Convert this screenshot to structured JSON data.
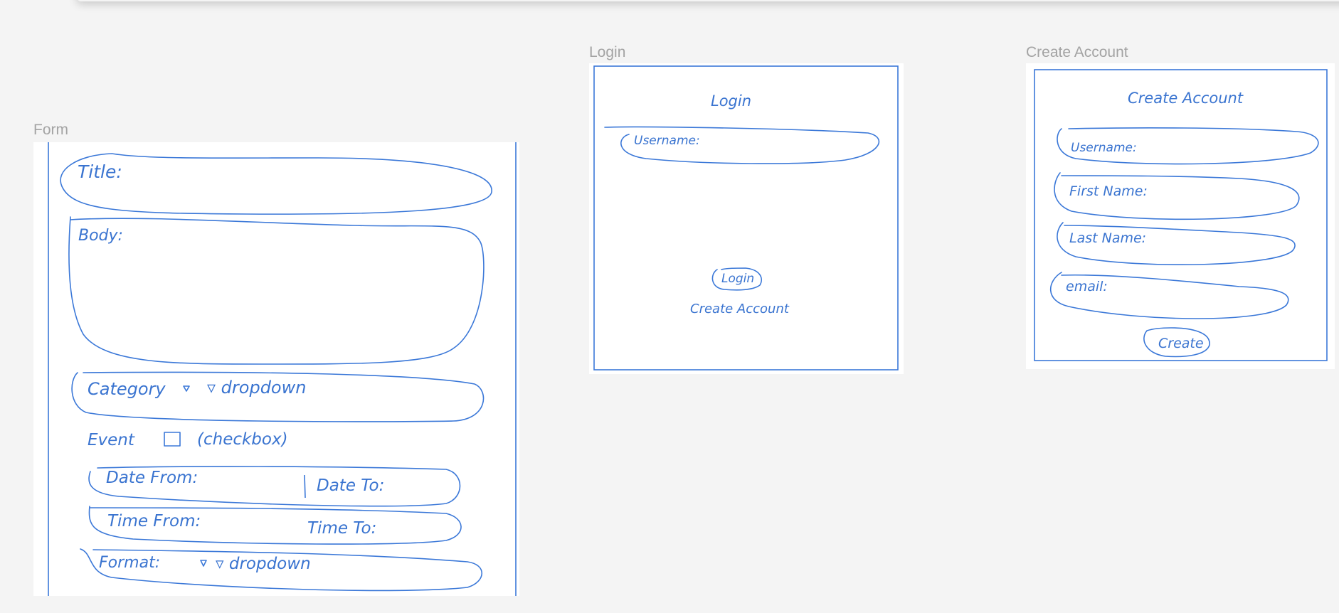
{
  "frames": {
    "form": {
      "label": "Form",
      "title_label": "Title:",
      "body_label": "Body:",
      "category_label": "Category",
      "category_dropdown": "▿ dropdown",
      "event_label": "Event",
      "event_checkbox_note": "(checkbox)",
      "date_from_label": "Date From:",
      "date_to_label": "Date To:",
      "time_from_label": "Time From:",
      "time_to_label": "Time To:",
      "format_label": "Format:",
      "format_dropdown": "▿ dropdown"
    },
    "login": {
      "label": "Login",
      "heading": "Login",
      "username_label": "Username:",
      "login_button": "Login",
      "create_account_link": "Create Account"
    },
    "create_account": {
      "label": "Create Account",
      "heading": "Create Account",
      "username_label": "Username:",
      "first_name_label": "First Name:",
      "last_name_label": "Last Name:",
      "email_label": "email:",
      "create_button": "Create"
    }
  },
  "colors": {
    "canvas": "#f4f4f4",
    "frame": "#ffffff",
    "sketch_ink": "#3b78d8",
    "frame_label": "#a3a3a3"
  }
}
